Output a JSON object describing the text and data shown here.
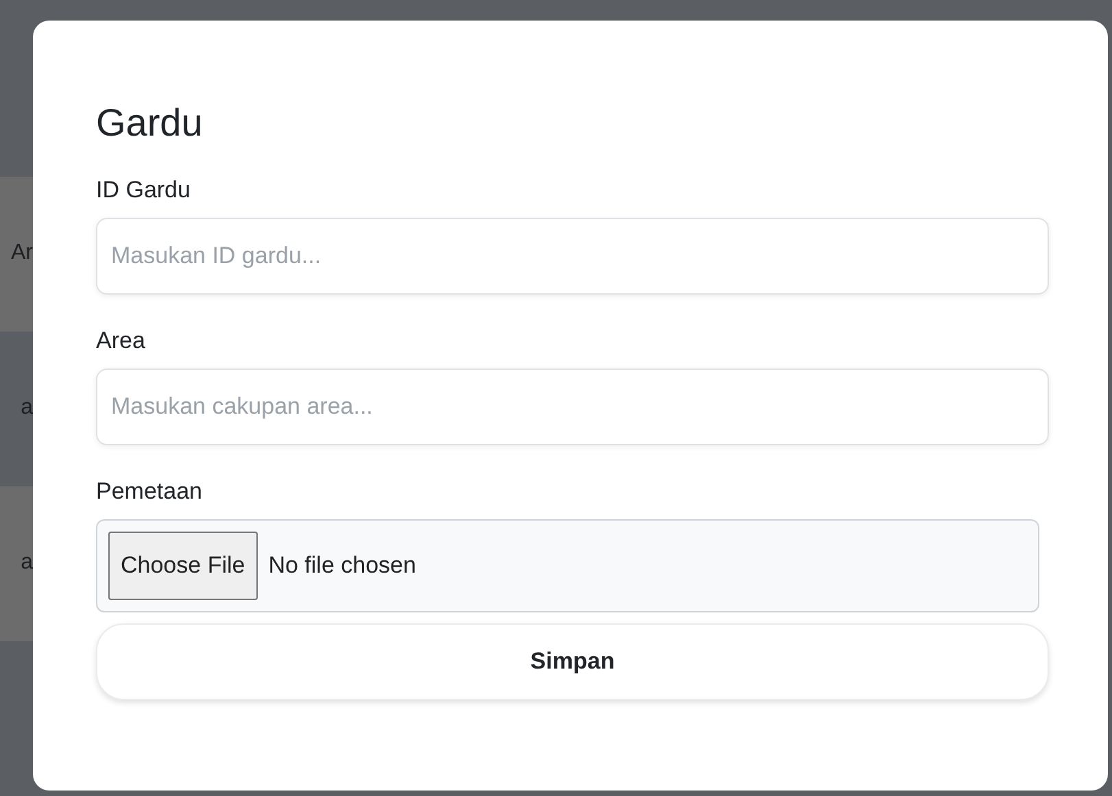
{
  "background_rows": [
    {
      "text": ""
    },
    {
      "text": "Ar"
    },
    {
      "text": "a"
    },
    {
      "text": "a"
    },
    {
      "text": ""
    }
  ],
  "modal": {
    "title": "Gardu",
    "fields": [
      {
        "kind": "text",
        "label": "ID Gardu",
        "placeholder": "Masukan ID gardu..."
      },
      {
        "kind": "text",
        "label": "Area",
        "placeholder": "Masukan cakupan area..."
      },
      {
        "kind": "file",
        "label": "Pemetaan",
        "button": "Choose File",
        "value": "No file chosen"
      }
    ],
    "submit": "Simpan"
  }
}
